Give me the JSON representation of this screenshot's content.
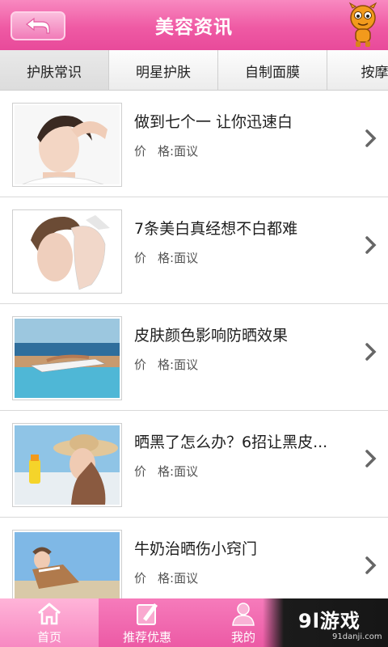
{
  "header": {
    "title": "美容资讯",
    "back_icon": "back-arrow-icon",
    "mascot_icon": "mascot-icon"
  },
  "tabs": [
    {
      "label": "护肤常识",
      "active": true
    },
    {
      "label": "明星护肤",
      "active": false
    },
    {
      "label": "自制面膜",
      "active": false
    },
    {
      "label": "按摩手",
      "active": false
    }
  ],
  "articles": [
    {
      "title": "做到七个一 让你迅速白",
      "price_label": "价",
      "price_value": "格:面议"
    },
    {
      "title": "7条美白真经想不白都难",
      "price_label": "价",
      "price_value": "格:面议"
    },
    {
      "title": "皮肤颜色影响防晒效果",
      "price_label": "价",
      "price_value": "格:面议"
    },
    {
      "title": "晒黑了怎么办？6招让黑皮...",
      "price_label": "价",
      "price_value": "格:面议"
    },
    {
      "title": "牛奶治晒伤小窍门",
      "price_label": "价",
      "price_value": "格:面议"
    }
  ],
  "bottom_nav": [
    {
      "label": "首页",
      "icon": "home-icon",
      "active": true
    },
    {
      "label": "推荐优惠",
      "icon": "recommend-icon",
      "active": false
    },
    {
      "label": "我的",
      "icon": "user-icon",
      "active": false
    }
  ],
  "watermark": {
    "main": "9l游戏",
    "sub": "91danji.com"
  },
  "colors": {
    "accent_pink": "#ef5aa4",
    "tab_bg": "#ececec",
    "watermark_bg": "#161616"
  }
}
